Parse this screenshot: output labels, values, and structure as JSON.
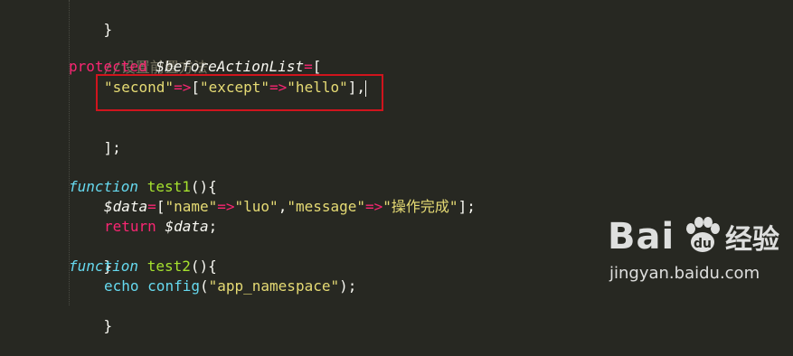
{
  "editor": {
    "lines": {
      "l1": {
        "brace": "}"
      },
      "l2": {
        "comment": "//设置前置方法"
      },
      "l3": {
        "protected": "protected",
        "var": "$beforeActionList",
        "eq": "=",
        "bracket": "["
      },
      "l4": {
        "s1": "\"second\"",
        "arrow1": "=>",
        "b1": "[",
        "s2": "\"except\"",
        "arrow2": "=>",
        "s3": "\"hello\"",
        "close": "],"
      },
      "l5": {
        "close": "];"
      },
      "l6": {
        "function": "function",
        "name": "test1",
        "rest": "(){"
      },
      "l7": {
        "var": "$data",
        "eq": "=",
        "b1": "[",
        "s1": "\"name\"",
        "arrow1": "=>",
        "s2": "\"luo\"",
        "comma": ",",
        "s3": "\"message\"",
        "arrow2": "=>",
        "s4": "\"操作完成\"",
        "close": "];"
      },
      "l8": {
        "return": "return",
        "var": "$data",
        "semi": ";"
      },
      "l9": {
        "brace": "}"
      },
      "l10": {
        "function": "function",
        "name": "test2",
        "rest": "(){"
      },
      "l11": {
        "echo": "echo",
        "fn": "config",
        "open": "(",
        "s1": "\"app_namespace\"",
        "close": ");"
      },
      "l12": {
        "brace": "}"
      }
    }
  },
  "watermark": {
    "logo": "Bai",
    "logo2": "du",
    "jingyan": "经验",
    "url": "jingyan.baidu.com"
  },
  "colors": {
    "background": "#272822",
    "keyword": "#f92672",
    "string": "#e6db74",
    "function_keyword": "#66d9ef",
    "function_name": "#a6e22e",
    "comment": "#75715e",
    "highlight_box": "#d0141d"
  }
}
